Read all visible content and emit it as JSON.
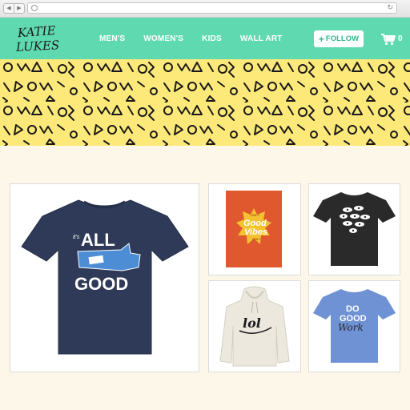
{
  "browser": {
    "back_icon": "chevron-left-icon",
    "forward_icon": "chevron-right-icon",
    "address_icon": "globe-icon",
    "reload_icon": "reload-icon"
  },
  "header": {
    "logo_line1": "KATIE",
    "logo_line2": "LUKES",
    "nav": [
      "MEN'S",
      "WOMEN'S",
      "KIDS",
      "WALL ART"
    ],
    "follow_label": "FOLLOW",
    "follow_icon": "plus-icon",
    "cart_icon": "cart-icon",
    "cart_count": "0",
    "colors": {
      "bar": "#5fdab0",
      "follow_text": "#35b88b"
    }
  },
  "banner": {
    "background": "#fce97a",
    "pattern": "memphis-shapes"
  },
  "products": [
    {
      "name": "all-good-tshirt",
      "text_lines": [
        "it's",
        "ALL",
        "GOOD"
      ],
      "shirt_color": "#2f3a58"
    },
    {
      "name": "good-vibes-print",
      "text_lines": [
        "ONLY",
        "Good",
        "Vibes",
        "ONLY"
      ],
      "background": "#e0582e"
    },
    {
      "name": "eyes-fish-tshirt",
      "shirt_color": "#2a2a2a"
    },
    {
      "name": "lol-hoodie",
      "text_lines": [
        "lol"
      ],
      "hoodie_color": "#ede8dd"
    },
    {
      "name": "do-good-work-tshirt",
      "text_lines": [
        "DO",
        "GOOD",
        "Work"
      ],
      "shirt_color": "#6e92d4"
    }
  ]
}
